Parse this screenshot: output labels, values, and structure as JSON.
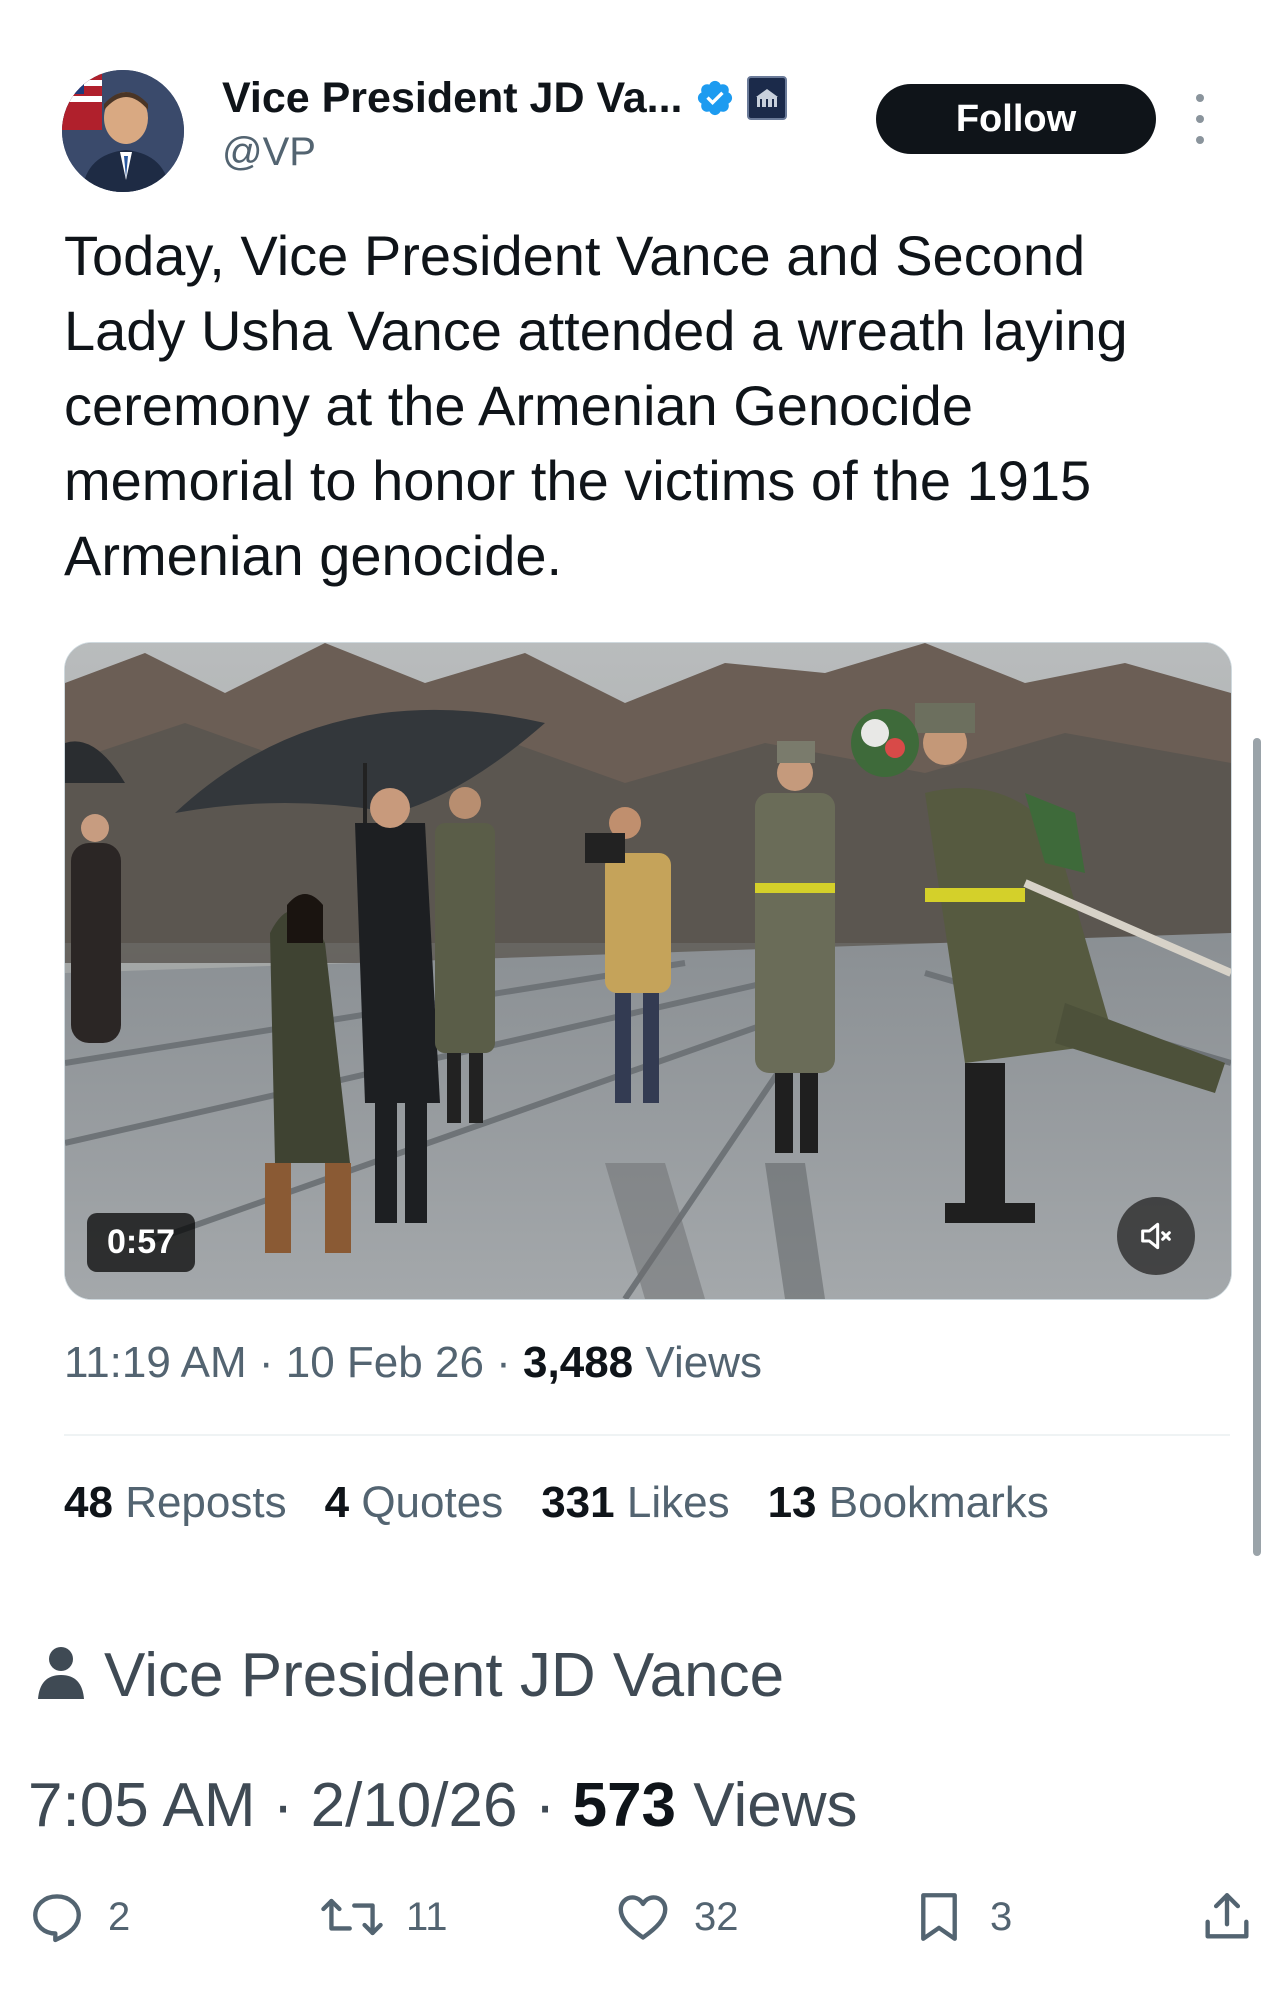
{
  "author": {
    "display_name": "Vice President JD Va...",
    "handle": "@VP",
    "verified_icon": "verified-badge-icon",
    "affiliation_icon": "white-house-badge-icon"
  },
  "follow_button": {
    "label": "Follow"
  },
  "tweet": {
    "text": "Today, Vice President Vance and Second Lady Usha Vance attended a wreath laying ceremony at the Armenian Genocide memorial to honor the victims of the 1915 Armenian genocide."
  },
  "video": {
    "duration": "0:57",
    "mute_icon": "muted-speaker-icon"
  },
  "meta": {
    "time": "11:19 AM",
    "date": "10 Feb 26",
    "views_count": "3,488",
    "views_label": "Views",
    "separator": "·"
  },
  "stats": [
    {
      "count": "48",
      "label": "Reposts"
    },
    {
      "count": "4",
      "label": "Quotes"
    },
    {
      "count": "331",
      "label": "Likes"
    },
    {
      "count": "13",
      "label": "Bookmarks"
    }
  ],
  "repost_context": {
    "icon": "person-icon",
    "name": "Vice President JD Vance",
    "time": "7:05 AM",
    "date": "2/10/26",
    "views_count": "573",
    "views_label": "Views",
    "separator": "·"
  },
  "actions": {
    "replies": "2",
    "reposts": "11",
    "likes": "32",
    "bookmarks": "3"
  },
  "colors": {
    "text_primary": "#0f1419",
    "text_secondary": "#536471",
    "verified_blue": "#1d9bf0",
    "follow_bg": "#0f1419"
  }
}
